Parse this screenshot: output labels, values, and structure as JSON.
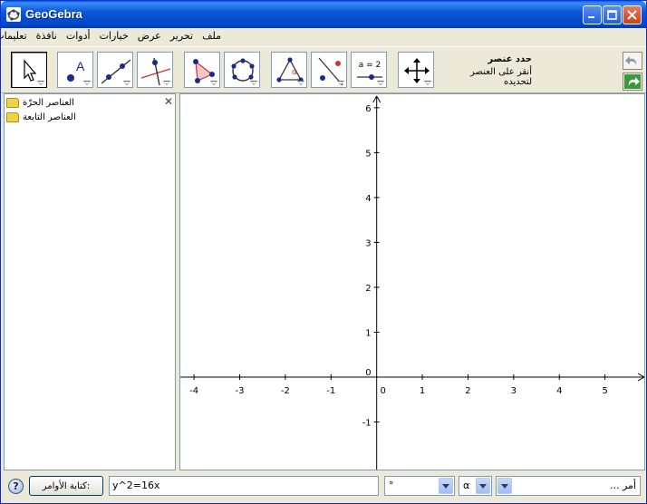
{
  "window": {
    "title": "GeoGebra"
  },
  "menu": [
    "ملف",
    "تحرير",
    "عرض",
    "خيارات",
    "أدوات",
    "نافذة",
    "تعليمات"
  ],
  "tool_help": {
    "title": "حدد عنصر",
    "hint": "أنقر على العنصر لتحديده"
  },
  "toolbar_tools": [
    {
      "icon": "move-arrow-icon",
      "selected": true
    },
    {
      "icon": "new-point-icon"
    },
    {
      "icon": "line-through-points-icon"
    },
    {
      "icon": "perpendicular-line-icon"
    },
    {
      "icon": "polygon-icon"
    },
    {
      "icon": "circle-icon"
    },
    {
      "icon": "angle-icon"
    },
    {
      "icon": "reflect-icon"
    },
    {
      "icon": "slider-icon",
      "label": "a = 2"
    },
    {
      "icon": "move-view-icon"
    }
  ],
  "algebra": {
    "items": [
      "العناصر الحرّة",
      "العناصر التابعة"
    ]
  },
  "graphics": {
    "x_ticks": [
      "-4",
      "-3",
      "-2",
      "-1",
      "0",
      "1",
      "2",
      "3",
      "4",
      "5"
    ],
    "y_ticks": [
      "6",
      "5",
      "4",
      "3",
      "2",
      "1",
      "0",
      "-1"
    ],
    "x_range": [
      -4.3,
      5.9
    ],
    "y_range": [
      -2.1,
      6.3
    ]
  },
  "input_bar": {
    "label": "كتابة الأوامر:",
    "value": "y^2=16x",
    "degree_symbol": "°",
    "greek_symbol": "α",
    "command_placeholder": "أمر ..."
  },
  "colors": {
    "titlebar": "#0a58d8",
    "accent": "#1a2a8a"
  }
}
